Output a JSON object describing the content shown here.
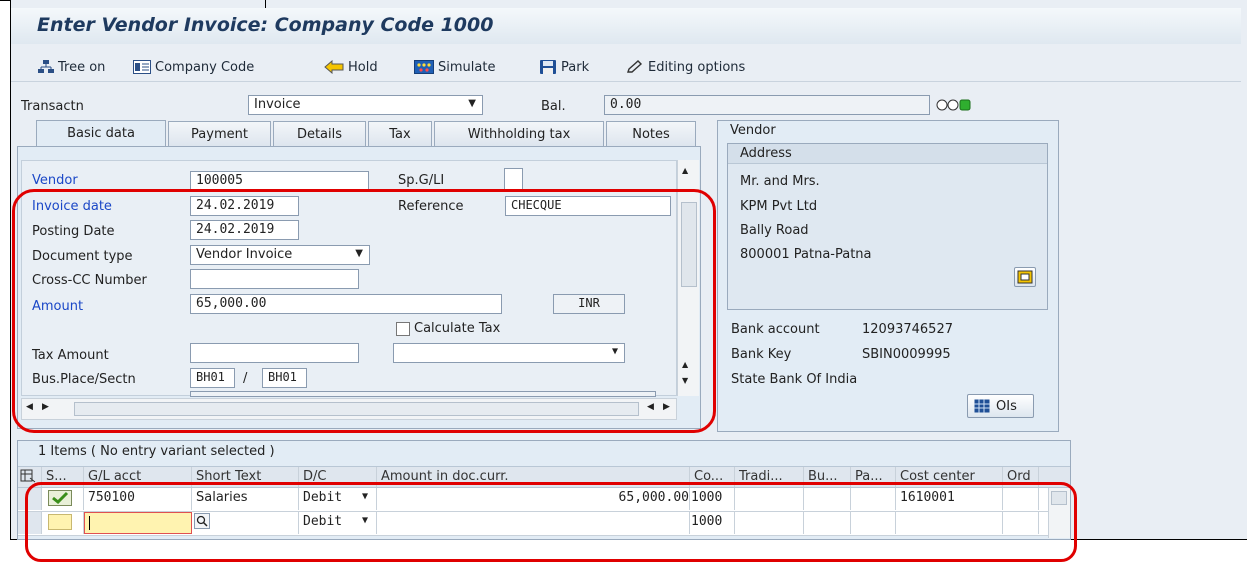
{
  "title": "Enter Vendor Invoice: Company Code 1000",
  "toolbar": {
    "tree_on": "Tree on",
    "company_code": "Company Code",
    "hold": "Hold",
    "simulate": "Simulate",
    "park": "Park",
    "editing_options": "Editing options"
  },
  "header": {
    "transactn_label": "Transactn",
    "transactn_value": "Invoice",
    "bal_label": "Bal.",
    "bal_value": "0.00"
  },
  "tabs": [
    "Basic data",
    "Payment",
    "Details",
    "Tax",
    "Withholding tax",
    "Notes"
  ],
  "basic": {
    "vendor_label": "Vendor",
    "vendor_value": "100005",
    "spgl_label": "Sp.G/LI",
    "invoice_date_label": "Invoice date",
    "invoice_date_value": "24.02.2019",
    "reference_label": "Reference",
    "reference_value": "CHECQUE",
    "posting_date_label": "Posting Date",
    "posting_date_value": "24.02.2019",
    "doc_type_label": "Document type",
    "doc_type_value": "Vendor Invoice",
    "cross_cc_label": "Cross-CC Number",
    "amount_label": "Amount",
    "amount_value": "65,000.00",
    "currency": "INR",
    "calc_tax_label": "Calculate Tax",
    "tax_amount_label": "Tax Amount",
    "bus_place_label": "Bus.Place/Sectn",
    "bus_place_value": "BH01",
    "separator": "/",
    "sectn_value": "BH01"
  },
  "vendor_panel": {
    "title": "Vendor",
    "address_title": "Address",
    "address_lines": [
      "Mr. and Mrs.",
      "KPM Pvt Ltd",
      "Bally Road",
      "800001 Patna-Patna"
    ],
    "bank_account_label": "Bank account",
    "bank_account_value": "12093746527",
    "bank_key_label": "Bank Key",
    "bank_key_value": "SBIN0009995",
    "bank_name": "State Bank Of India",
    "ois_button": "OIs"
  },
  "items": {
    "caption": "1 Items ( No entry variant selected )",
    "columns": [
      "S...",
      "G/L acct",
      "Short Text",
      "D/C",
      "Amount in doc.curr.",
      "Co...",
      "Tradi...",
      "Bu...",
      "Pa...",
      "Cost center",
      "Ord"
    ],
    "rows": [
      {
        "gl": "750100",
        "text": "Salaries",
        "dc": "Debit",
        "amount": "65,000.00",
        "co": "1000",
        "cost_center": "1610001"
      },
      {
        "gl": "",
        "text": "",
        "dc": "Debit",
        "amount": "",
        "co": "1000",
        "cost_center": ""
      }
    ]
  },
  "colors": {
    "accent": "#1a47c7",
    "highlight": "#e00000",
    "status_green": "#2fae2f"
  }
}
